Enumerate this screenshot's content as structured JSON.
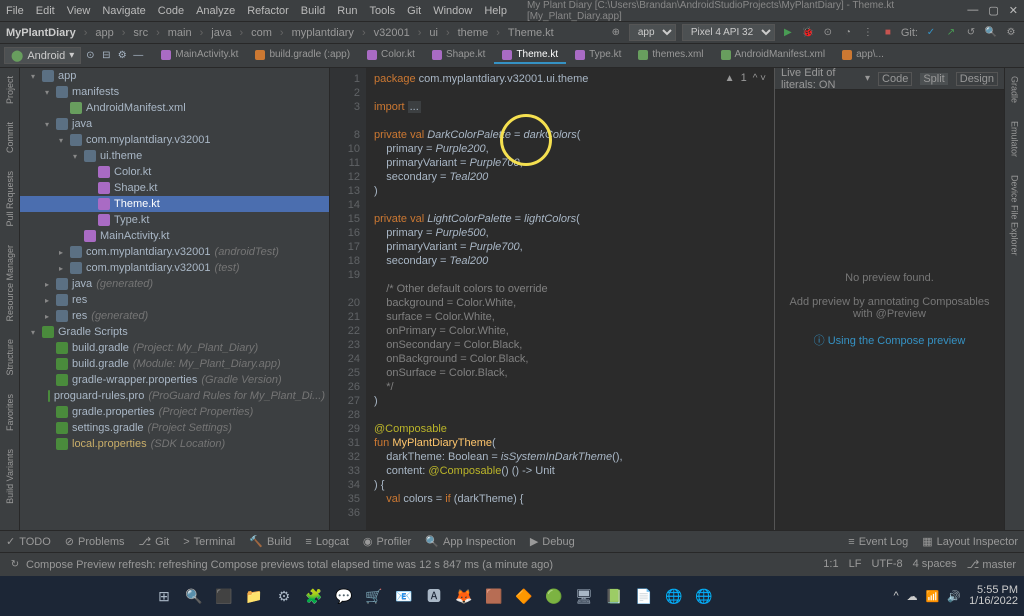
{
  "menu": [
    "File",
    "Edit",
    "View",
    "Navigate",
    "Code",
    "Analyze",
    "Refactor",
    "Build",
    "Run",
    "Tools",
    "Git",
    "Window",
    "Help"
  ],
  "window_title": "My Plant Diary [C:\\Users\\Brandan\\AndroidStudioProjects\\MyPlantDiary] - Theme.kt [My_Plant_Diary.app]",
  "crumbs": [
    "MyPlantDiary",
    "app",
    "src",
    "main",
    "java",
    "com",
    "myplantdiary",
    "v32001",
    "ui",
    "theme",
    "Theme.kt"
  ],
  "run_config": "app",
  "device": "Pixel 4 API 32",
  "git_label": "Git:",
  "android_dd": "Android",
  "editor_tabs": [
    {
      "label": "MainActivity.kt",
      "icon": "kt"
    },
    {
      "label": "build.gradle (:app)",
      "icon": "gr"
    },
    {
      "label": "Color.kt",
      "icon": "kt"
    },
    {
      "label": "Shape.kt",
      "icon": "kt"
    },
    {
      "label": "Theme.kt",
      "icon": "kt",
      "active": true
    },
    {
      "label": "Type.kt",
      "icon": "kt"
    },
    {
      "label": "themes.xml",
      "icon": "xml"
    },
    {
      "label": "AndroidManifest.xml",
      "icon": "xml"
    },
    {
      "label": "app\\...",
      "icon": "gr"
    }
  ],
  "leftrail": [
    "Project",
    "Commit",
    "Pull Requests",
    "Resource Manager",
    "Structure",
    "Favorites",
    "Build Variants"
  ],
  "rightrail": [
    "Gradle",
    "Emulator",
    "Device File Explorer"
  ],
  "tree": [
    {
      "d": 0,
      "a": "v",
      "i": "fold",
      "t": "app",
      "bold": true
    },
    {
      "d": 1,
      "a": "v",
      "i": "fold",
      "t": "manifests"
    },
    {
      "d": 2,
      "a": "",
      "i": "xml",
      "t": "AndroidManifest.xml"
    },
    {
      "d": 1,
      "a": "v",
      "i": "fold",
      "t": "java"
    },
    {
      "d": 2,
      "a": "v",
      "i": "fold",
      "t": "com.myplantdiary.v32001"
    },
    {
      "d": 3,
      "a": "v",
      "i": "fold",
      "t": "ui.theme"
    },
    {
      "d": 4,
      "a": "",
      "i": "kt",
      "t": "Color.kt"
    },
    {
      "d": 4,
      "a": "",
      "i": "kt",
      "t": "Shape.kt"
    },
    {
      "d": 4,
      "a": "",
      "i": "kt",
      "t": "Theme.kt",
      "sel": true
    },
    {
      "d": 4,
      "a": "",
      "i": "kt",
      "t": "Type.kt"
    },
    {
      "d": 3,
      "a": "",
      "i": "kt",
      "t": "MainActivity.kt"
    },
    {
      "d": 2,
      "a": ">",
      "i": "fold",
      "t": "com.myplantdiary.v32001",
      "dim": "(androidTest)"
    },
    {
      "d": 2,
      "a": ">",
      "i": "fold",
      "t": "com.myplantdiary.v32001",
      "dim": "(test)"
    },
    {
      "d": 1,
      "a": ">",
      "i": "fold",
      "t": "java",
      "dim": "(generated)"
    },
    {
      "d": 1,
      "a": ">",
      "i": "fold",
      "t": "res"
    },
    {
      "d": 1,
      "a": ">",
      "i": "fold",
      "t": "res",
      "dim": "(generated)"
    },
    {
      "d": 0,
      "a": "v",
      "i": "gr",
      "t": "Gradle Scripts",
      "bold": true
    },
    {
      "d": 1,
      "a": "",
      "i": "gr",
      "t": "build.gradle",
      "dim": "(Project: My_Plant_Diary)"
    },
    {
      "d": 1,
      "a": "",
      "i": "gr",
      "t": "build.gradle",
      "dim": "(Module: My_Plant_Diary.app)"
    },
    {
      "d": 1,
      "a": "",
      "i": "gr",
      "t": "gradle-wrapper.properties",
      "dim": "(Gradle Version)"
    },
    {
      "d": 1,
      "a": "",
      "i": "gr",
      "t": "proguard-rules.pro",
      "dim": "(ProGuard Rules for My_Plant_Di...)"
    },
    {
      "d": 1,
      "a": "",
      "i": "gr",
      "t": "gradle.properties",
      "dim": "(Project Properties)"
    },
    {
      "d": 1,
      "a": "",
      "i": "gr",
      "t": "settings.gradle",
      "dim": "(Project Settings)"
    },
    {
      "d": 1,
      "a": "",
      "i": "gr",
      "t": "local.properties",
      "dim": "(SDK Location)",
      "hl": true
    }
  ],
  "line_start": 1,
  "code_lines": [
    "<span class='kw'>package</span> <span class='pkg'>com.myplantdiary.v32001.ui.theme</span>",
    "",
    "<span class='kw'>import</span> <span style='background:#3c3f41;padding:0 2px'>...</span>",
    "",
    "<span class='kw'>private val</span> <span class='typ'>DarkColorPalette</span> = <span class='typ'>darkColors</span>(",
    "    primary = <span class='typ'>Purple200</span>,",
    "    primaryVariant = <span class='typ'>Purple700</span>,",
    "    secondary = <span class='typ'>Teal200</span>",
    ")",
    "",
    "<span class='kw'>private val</span> <span class='typ'>LightColorPalette</span> = <span class='typ'>lightColors</span>(",
    "    primary = <span class='typ'>Purple500</span>,",
    "    primaryVariant = <span class='typ'>Purple700</span>,",
    "    secondary = <span class='typ'>Teal200</span>",
    "",
    "    <span class='com'>/* Other default colors to override</span>",
    "    <span class='com'>background = Color.White,</span>",
    "    <span class='com'>surface = Color.White,</span>",
    "    <span class='com'>onPrimary = Color.White,</span>",
    "    <span class='com'>onSecondary = Color.Black,</span>",
    "    <span class='com'>onBackground = Color.Black,</span>",
    "    <span class='com'>onSurface = Color.Black,</span>",
    "    <span class='com'>*/</span>",
    ")",
    "",
    "<span class='ann'>@Composable</span>",
    "<span class='kw'>fun</span> <span class='fn'>MyPlantDiaryTheme</span>(",
    "    darkTheme: Boolean = <span class='typ'>isSystemInDarkTheme</span>(),",
    "    content: <span class='ann'>@Composable</span>() () -> Unit",
    ") {",
    "    <span class='kw'>val</span> colors = <span class='kw'>if</span> (darkTheme) {"
  ],
  "line_numbers_skip": [
    1,
    2,
    3,
    null,
    8,
    10,
    11,
    12,
    13,
    14,
    15,
    16,
    17,
    18,
    19,
    null,
    20,
    21,
    22,
    23,
    24,
    25,
    26,
    27,
    28,
    29,
    31,
    32,
    33,
    34,
    35,
    36
  ],
  "warn_count": "1",
  "preview": {
    "toggle": "Live Edit of literals: ON",
    "views": [
      "Code",
      "Split",
      "Design"
    ],
    "msg": "No preview found.",
    "hint": "Add preview by annotating Composables with @Preview",
    "link": "Using the Compose preview"
  },
  "bottom": [
    {
      "i": "✓",
      "t": "TODO"
    },
    {
      "i": "⊘",
      "t": "Problems"
    },
    {
      "i": "⎇",
      "t": "Git"
    },
    {
      "i": ">",
      "t": "Terminal"
    },
    {
      "i": "🔨",
      "t": "Build"
    },
    {
      "i": "≡",
      "t": "Logcat"
    },
    {
      "i": "◉",
      "t": "Profiler"
    },
    {
      "i": "🔍",
      "t": "App Inspection"
    },
    {
      "i": "▶",
      "t": "Debug"
    }
  ],
  "bottom_right": [
    {
      "i": "≡",
      "t": "Event Log"
    },
    {
      "i": "▦",
      "t": "Layout Inspector"
    }
  ],
  "status_msg": "Compose Preview refresh: refreshing Compose previews total elapsed time was 12 s 847 ms (a minute ago)",
  "status_right": [
    "1:1",
    "LF",
    "UTF-8",
    "4 spaces",
    "⎇ master"
  ],
  "taskbar_icons": [
    "⊞",
    "🔍",
    "⬛",
    "📁",
    "⚙",
    "🧩",
    "💬",
    "🛒",
    "📧",
    "🅰",
    "🦊",
    "🟫",
    "🔶",
    "🟢",
    "🖥",
    "📗",
    "📄",
    "🌐",
    "🌐"
  ],
  "tray": {
    "time": "5:55 PM",
    "date": "1/16/2022",
    "net": "📶"
  }
}
